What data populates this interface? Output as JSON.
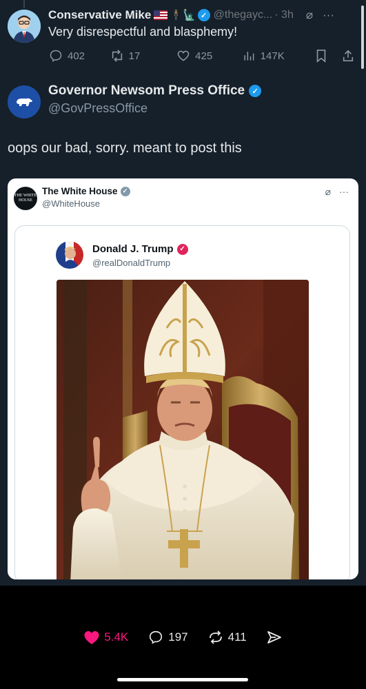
{
  "reply": {
    "author_name": "Conservative Mike",
    "emoji_flag": "flag-us",
    "emoji_extra": "🕴🗽",
    "handle": "@thegayc...",
    "time": "· 3h",
    "text": "Very disrespectful and blasphemy!",
    "actions": {
      "replies": "402",
      "reposts": "17",
      "likes": "425",
      "views": "147K"
    }
  },
  "main_post": {
    "author_name": "Governor Newsom Press Office",
    "handle": "@GovPressOffice",
    "text": "oops our bad, sorry. meant to post this"
  },
  "embedded": {
    "author_name": "The White House",
    "handle": "@WhiteHouse",
    "avatar_text": "THE WHITE HOUSE",
    "quoted": {
      "author_name": "Donald J. Trump",
      "handle": "@realDonaldTrump"
    }
  },
  "bottom_bar": {
    "likes": "5.4K",
    "comments": "197",
    "reposts": "411"
  },
  "colors": {
    "background": "#15202b",
    "verified": "#1d9bf0",
    "like": "#f91880"
  }
}
